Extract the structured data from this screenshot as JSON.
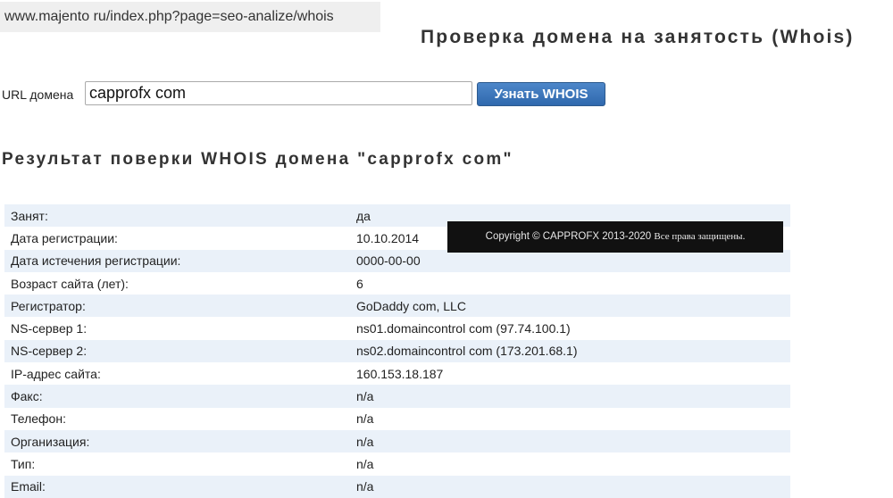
{
  "address_bar": {
    "url": "www.majento ru/index.php?page=seo-analize/whois"
  },
  "page": {
    "title": "Проверка домена на занятость (Whois)"
  },
  "form": {
    "url_label": "URL домена",
    "domain_value": "capprofx com",
    "submit_label": "Узнать WHOIS"
  },
  "result": {
    "heading": "Результат поверки WHOIS домена \"capprofx com\""
  },
  "whois_rows": [
    {
      "label": "Занят:",
      "value": "да"
    },
    {
      "label": "Дата регистрации:",
      "value": "10.10.2014"
    },
    {
      "label": "Дата истечения регистрации:",
      "value": "0000-00-00"
    },
    {
      "label": "Возраст сайта (лет):",
      "value": "6"
    },
    {
      "label": "Регистратор:",
      "value": "GoDaddy com, LLC"
    },
    {
      "label": "NS-сервер 1:",
      "value": "ns01.domaincontrol com (97.74.100.1)"
    },
    {
      "label": "NS-сервер 2:",
      "value": "ns02.domaincontrol com (173.201.68.1)"
    },
    {
      "label": "IP-адрес сайта:",
      "value": "160.153.18.187"
    },
    {
      "label": "Факс:",
      "value": "n/a"
    },
    {
      "label": "Телефон:",
      "value": "n/a"
    },
    {
      "label": "Организация:",
      "value": "n/a"
    },
    {
      "label": "Тип:",
      "value": "n/a"
    },
    {
      "label": "Email:",
      "value": "n/a"
    }
  ],
  "overlay": {
    "copyright": "Copyright © CAPPROFX 2013-2020",
    "rights": "Все права защищены."
  },
  "colors": {
    "row_stripe": "#eaf1f9",
    "button": "#2f68ad",
    "overlay_bg": "#111111"
  }
}
